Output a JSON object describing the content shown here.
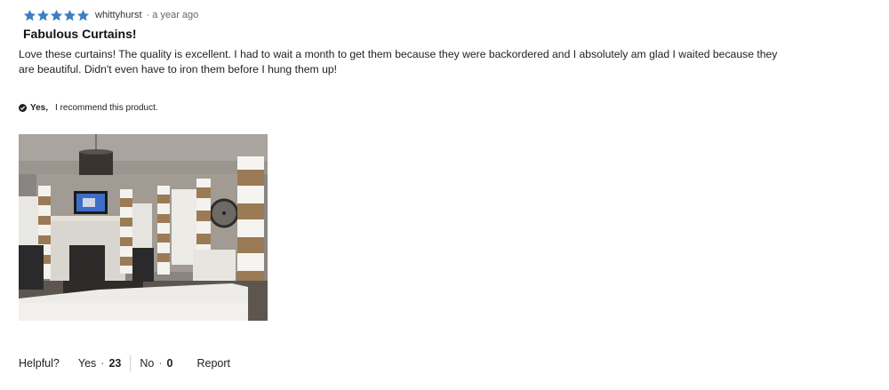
{
  "review": {
    "rating": 5,
    "rating_max": 5,
    "author": "whittyhurst",
    "date": "· a year ago",
    "title": "Fabulous Curtains!",
    "body": "Love these curtains! The quality is excellent. I had to wait a month to get them because they were backordered and I absolutely am glad I waited because they are beautiful. Didn't even have to iron them before I hung them up!",
    "recommend": {
      "yes_label": "Yes,",
      "text": "I recommend this product."
    }
  },
  "helpful": {
    "label": "Helpful?",
    "yes_label": "Yes",
    "yes_count": "23",
    "no_label": "No",
    "no_count": "0",
    "separator": "·",
    "report_label": "Report"
  },
  "colors": {
    "star": "#3b7fc4",
    "divider": "#cfcfcf",
    "text": "#222222"
  },
  "icons": {
    "star": "star-icon",
    "check": "check-circle-icon"
  }
}
